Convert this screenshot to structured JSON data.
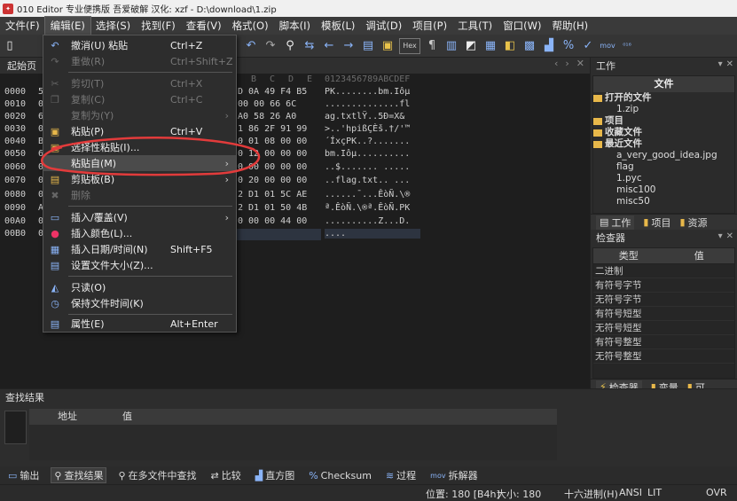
{
  "window": {
    "title": "010 Editor 专业便携版 吾爱破解 汉化: xzf - D:\\download\\1.zip"
  },
  "menubar": [
    "文件(F)",
    "编辑(E)",
    "选择(S)",
    "找到(F)",
    "查看(V)",
    "格式(O)",
    "脚本(I)",
    "模板(L)",
    "调试(D)",
    "项目(P)",
    "工具(T)",
    "窗口(W)",
    "帮助(H)"
  ],
  "editor": {
    "tab_label": "起始页",
    "hex_header_cols": [
      "B",
      "C",
      "D",
      "E",
      "F"
    ],
    "ascii_header": "0123456789ABCDEF",
    "addresses": [
      "0000",
      "0010",
      "0020",
      "0030",
      "0040",
      "0050",
      "0060",
      "0070",
      "0080",
      "0090",
      "00A0",
      "00B0"
    ],
    "left_digits": [
      "5",
      "0",
      "6",
      "0",
      "B",
      "6",
      "0",
      "0",
      "0",
      "A",
      "0",
      "0"
    ],
    "hex_tails": [
      "D 0A 49 F4 B5",
      "00 00 66 6C",
      "A0 58 26 A0",
      "1 86 2F 91 99",
      "0 01 08 00 00",
      "0 12 00 00 00",
      "0 00 00 00 00",
      "0 20 00 00 00",
      "2 D1 01 5C AE",
      "2 D1 01 50 4B",
      "0 00 00 44 00",
      ""
    ],
    "ascii_rows": [
      "PK........bm.Iôµ",
      "..............fl",
      "ag.txtlŸ..5Ð=X&",
      ">..'hpißÇÈš.†/'™",
      "´ÍxçPK..?.......",
      "bm.Iôµ..........",
      "..$....... .....",
      "..flag.txt.. ...",
      "......¯...ÊòÑ.\\®",
      "ª.ÊòÑ.\\®ª.ÊòÑ.PK",
      "..........Z...D.",
      "...."
    ]
  },
  "edit_menu": {
    "items": [
      {
        "label": "撤消(U) 粘贴",
        "shortcut": "Ctrl+Z",
        "icon": "undo-icon"
      },
      {
        "label": "重做(R)",
        "shortcut": "Ctrl+Shift+Z",
        "icon": "redo-icon"
      },
      {
        "label": "剪切(T)",
        "shortcut": "Ctrl+X",
        "icon": "cut-icon"
      },
      {
        "label": "复制(C)",
        "shortcut": "Ctrl+C",
        "icon": "copy-icon"
      },
      {
        "label": "复制为(Y)",
        "shortcut": "",
        "icon": ""
      },
      {
        "label": "粘贴(P)",
        "shortcut": "Ctrl+V",
        "icon": "paste-icon"
      },
      {
        "label": "选择性粘贴(I)...",
        "shortcut": "",
        "icon": "paste-special-icon"
      },
      {
        "label": "粘贴自(M)",
        "shortcut": "",
        "icon": ""
      },
      {
        "label": "剪贴板(B)",
        "shortcut": "",
        "icon": "clipboard-icon"
      },
      {
        "label": "删除",
        "shortcut": "",
        "icon": "delete-icon"
      },
      {
        "label": "插入/覆盖(V)",
        "shortcut": "",
        "icon": "insert-icon"
      },
      {
        "label": "插入颜色(L)...",
        "shortcut": "",
        "icon": "color-wheel-icon"
      },
      {
        "label": "插入日期/时间(N)",
        "shortcut": "Shift+F5",
        "icon": "calendar-icon"
      },
      {
        "label": "设置文件大小(Z)...",
        "shortcut": "",
        "icon": "file-size-icon"
      },
      {
        "label": "只读(O)",
        "shortcut": "",
        "icon": "lock-icon"
      },
      {
        "label": "保持文件时间(K)",
        "shortcut": "",
        "icon": "clock-icon"
      },
      {
        "label": "属性(E)",
        "shortcut": "Alt+Enter",
        "icon": "properties-icon"
      }
    ]
  },
  "workspace": {
    "title": "工作",
    "files_header": "文件",
    "open_files": "打开的文件",
    "open_file_1": "1.zip",
    "projects": "项目",
    "favorites": "收藏文件",
    "recent": "最近文件",
    "recent_files": [
      "a_very_good_idea.jpg",
      "flag",
      "1.pyc",
      "misc100",
      "misc50"
    ],
    "tabs": [
      "工作",
      "项目",
      "资源"
    ]
  },
  "inspector": {
    "title": "检查器",
    "col_type": "类型",
    "col_value": "值",
    "rows": [
      "二进制",
      "有符号字节",
      "无符号字节",
      "有符号短型",
      "无符号短型",
      "有符号整型",
      "无符号整型"
    ],
    "tabs": [
      "检查器",
      "变量",
      "可"
    ]
  },
  "find_results": {
    "title": "查找结果",
    "col_addr": "地址",
    "col_value": "值"
  },
  "bottom_tabs": [
    "输出",
    "查找结果",
    "在多文件中查找",
    "比较",
    "直方图",
    "Checksum",
    "过程",
    "拆解器"
  ],
  "status": {
    "position": "位置: 180 [B4h]",
    "size": "大小:   180",
    "mode": "十六进制(H)",
    "encoding": "ANSI",
    "endian": "LIT",
    "ovr": "OVR"
  },
  "colors": {
    "accent": "#8ab4f8",
    "highlight_annotation": "#e23b3b",
    "folder": "#e8b84a"
  }
}
